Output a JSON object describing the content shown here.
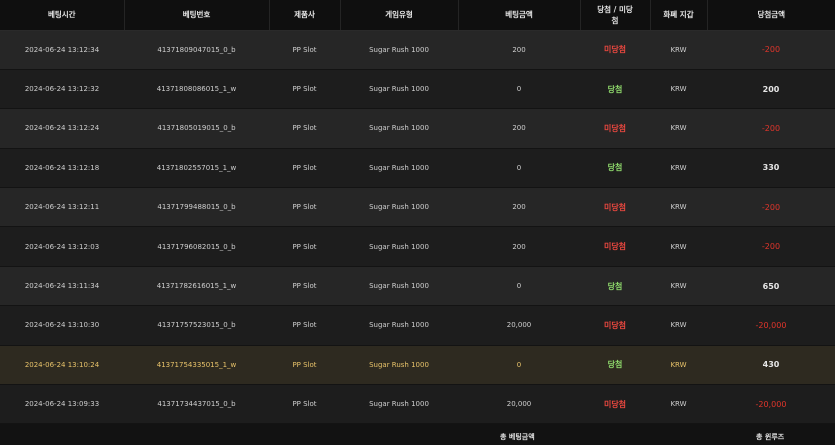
{
  "headers": [
    "베팅시간",
    "베팅번호",
    "제품사",
    "게임유형",
    "베팅금액",
    "당첨 / 미당첨",
    "화폐 지갑",
    "당첨금액"
  ],
  "rows": [
    {
      "time": "2024-06-24 13:12:34",
      "bet_no": "41371809047015_0_b",
      "provider": "PP Slot",
      "game": "Sugar Rush 1000",
      "bet": "200",
      "result": "미당첨",
      "status": "lose",
      "currency": "KRW",
      "win": "-200"
    },
    {
      "time": "2024-06-24 13:12:32",
      "bet_no": "41371808086015_1_w",
      "provider": "PP Slot",
      "game": "Sugar Rush 1000",
      "bet": "0",
      "result": "당첨",
      "status": "win",
      "currency": "KRW",
      "win": "200"
    },
    {
      "time": "2024-06-24 13:12:24",
      "bet_no": "41371805019015_0_b",
      "provider": "PP Slot",
      "game": "Sugar Rush 1000",
      "bet": "200",
      "result": "미당첨",
      "status": "lose",
      "currency": "KRW",
      "win": "-200"
    },
    {
      "time": "2024-06-24 13:12:18",
      "bet_no": "41371802557015_1_w",
      "provider": "PP Slot",
      "game": "Sugar Rush 1000",
      "bet": "0",
      "result": "당첨",
      "status": "win",
      "currency": "KRW",
      "win": "330"
    },
    {
      "time": "2024-06-24 13:12:11",
      "bet_no": "41371799488015_0_b",
      "provider": "PP Slot",
      "game": "Sugar Rush 1000",
      "bet": "200",
      "result": "미당첨",
      "status": "lose",
      "currency": "KRW",
      "win": "-200"
    },
    {
      "time": "2024-06-24 13:12:03",
      "bet_no": "41371796082015_0_b",
      "provider": "PP Slot",
      "game": "Sugar Rush 1000",
      "bet": "200",
      "result": "미당첨",
      "status": "lose",
      "currency": "KRW",
      "win": "-200"
    },
    {
      "time": "2024-06-24 13:11:34",
      "bet_no": "41371782616015_1_w",
      "provider": "PP Slot",
      "game": "Sugar Rush 1000",
      "bet": "0",
      "result": "당첨",
      "status": "win",
      "currency": "KRW",
      "win": "650"
    },
    {
      "time": "2024-06-24 13:10:30",
      "bet_no": "41371757523015_0_b",
      "provider": "PP Slot",
      "game": "Sugar Rush 1000",
      "bet": "20,000",
      "result": "미당첨",
      "status": "lose",
      "currency": "KRW",
      "win": "-20,000"
    },
    {
      "time": "2024-06-24 13:10:24",
      "bet_no": "41371754335015_1_w",
      "provider": "PP Slot",
      "game": "Sugar Rush 1000",
      "bet": "0",
      "result": "당첨",
      "status": "win",
      "currency": "KRW",
      "win": "430",
      "highlight": true
    },
    {
      "time": "2024-06-24 13:09:33",
      "bet_no": "41371734437015_0_b",
      "provider": "PP Slot",
      "game": "Sugar Rush 1000",
      "bet": "20,000",
      "result": "미당첨",
      "status": "lose",
      "currency": "KRW",
      "win": "-20,000"
    }
  ],
  "footer": {
    "total_bet_label": "총 베팅금액",
    "total_win_label": "총 윈루즈"
  },
  "colors": {
    "win": "#8ed86b",
    "lose": "#e8473f",
    "negative_amount": "#e0352b",
    "highlight_text": "#e8c36a"
  }
}
